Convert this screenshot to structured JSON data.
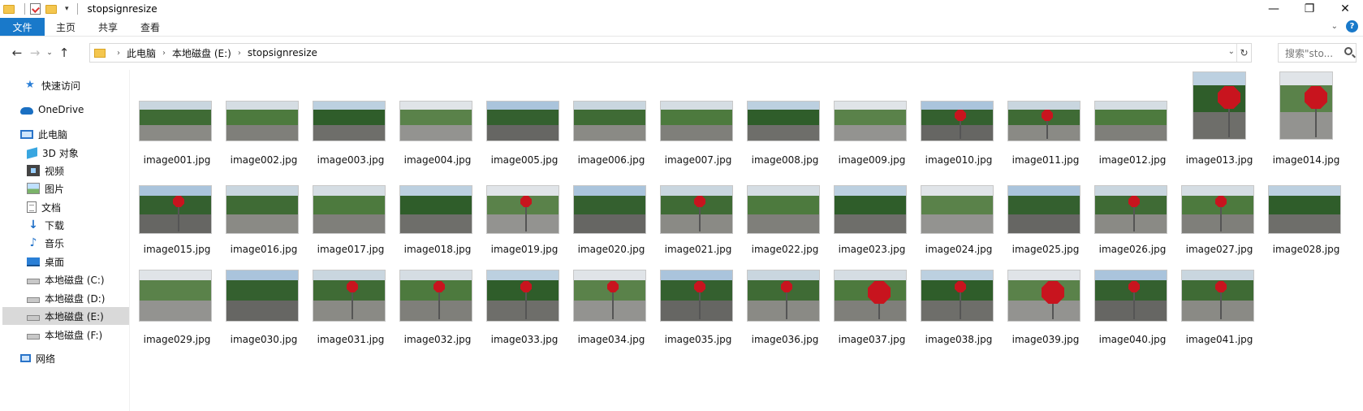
{
  "window": {
    "title": "stopsignresize",
    "controls": {
      "minimize": "—",
      "maximize": "❐",
      "close": "✕"
    }
  },
  "ribbon": {
    "tabs": [
      "文件",
      "主页",
      "共享",
      "查看"
    ]
  },
  "address": {
    "crumbs": [
      "此电脑",
      "本地磁盘 (E:)",
      "stopsignresize"
    ],
    "search_placeholder": "搜索\"sto..."
  },
  "sidebar": {
    "items": [
      {
        "label": "快速访问",
        "icon": "star-icon"
      },
      {
        "label": "OneDrive",
        "icon": "cloud-icon"
      },
      {
        "label": "此电脑",
        "icon": "computer-icon"
      },
      {
        "label": "3D 对象",
        "icon": "cube-icon"
      },
      {
        "label": "视频",
        "icon": "video-icon"
      },
      {
        "label": "图片",
        "icon": "picture-icon"
      },
      {
        "label": "文档",
        "icon": "document-icon"
      },
      {
        "label": "下载",
        "icon": "download-icon"
      },
      {
        "label": "音乐",
        "icon": "music-icon"
      },
      {
        "label": "桌面",
        "icon": "desktop-icon"
      },
      {
        "label": "本地磁盘 (C:)",
        "icon": "drive-icon"
      },
      {
        "label": "本地磁盘 (D:)",
        "icon": "drive-icon"
      },
      {
        "label": "本地磁盘 (E:)",
        "icon": "drive-icon",
        "selected": true
      },
      {
        "label": "本地磁盘 (F:)",
        "icon": "drive-icon"
      },
      {
        "label": "网络",
        "icon": "network-icon"
      }
    ]
  },
  "files": [
    "image001.jpg",
    "image002.jpg",
    "image003.jpg",
    "image004.jpg",
    "image005.jpg",
    "image006.jpg",
    "image007.jpg",
    "image008.jpg",
    "image009.jpg",
    "image010.jpg",
    "image011.jpg",
    "image012.jpg",
    "image013.jpg",
    "image014.jpg",
    "image015.jpg",
    "image016.jpg",
    "image017.jpg",
    "image018.jpg",
    "image019.jpg",
    "image020.jpg",
    "image021.jpg",
    "image022.jpg",
    "image023.jpg",
    "image024.jpg",
    "image025.jpg",
    "image026.jpg",
    "image027.jpg",
    "image028.jpg",
    "image029.jpg",
    "image030.jpg",
    "image031.jpg",
    "image032.jpg",
    "image033.jpg",
    "image034.jpg",
    "image035.jpg",
    "image036.jpg",
    "image037.jpg",
    "image038.jpg",
    "image039.jpg",
    "image040.jpg",
    "image041.jpg"
  ],
  "colors": {
    "accent": "#1979ca",
    "selected_bg": "#d9d9d9",
    "stop_red": "#c8141e"
  }
}
